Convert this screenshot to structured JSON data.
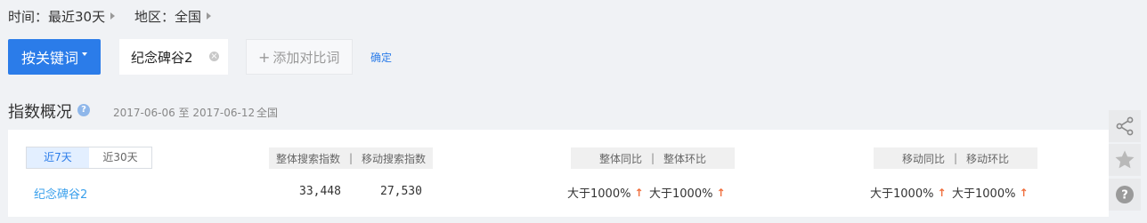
{
  "filters": {
    "time": "时间：最近30天",
    "region": "地区：全国"
  },
  "keyword_bar": {
    "primary_button": "按关键词",
    "keyword": "纪念碑谷2",
    "add_compare": "添加对比词",
    "confirm": "确定"
  },
  "overview": {
    "title": "指数概况",
    "help": "?",
    "date_range": "2017-06-06 至 2017-06-12",
    "region": "全国",
    "tabs": [
      "近7天",
      "近30天"
    ],
    "headers": {
      "overall_index": "整体搜索指数",
      "mobile_index": "移动搜索指数",
      "overall_yoy": "整体同比",
      "overall_mom": "整体环比",
      "mobile_yoy": "移动同比",
      "mobile_mom": "移动环比",
      "separator": "|"
    },
    "row": {
      "keyword": "纪念碑谷2",
      "overall_index": "33,448",
      "mobile_index": "27,530",
      "overall_yoy": "大于1000%",
      "overall_mom": "大于1000%",
      "mobile_yoy": "大于1000%",
      "mobile_mom": "大于1000%"
    }
  },
  "colors": {
    "primary": "#2b7ce9",
    "link": "#3aa0ec",
    "up": "#f06e3c"
  },
  "icons": [
    "share-icon",
    "star-icon",
    "question-icon",
    "remove-icon",
    "plus-icon",
    "up-arrow-icon"
  ]
}
